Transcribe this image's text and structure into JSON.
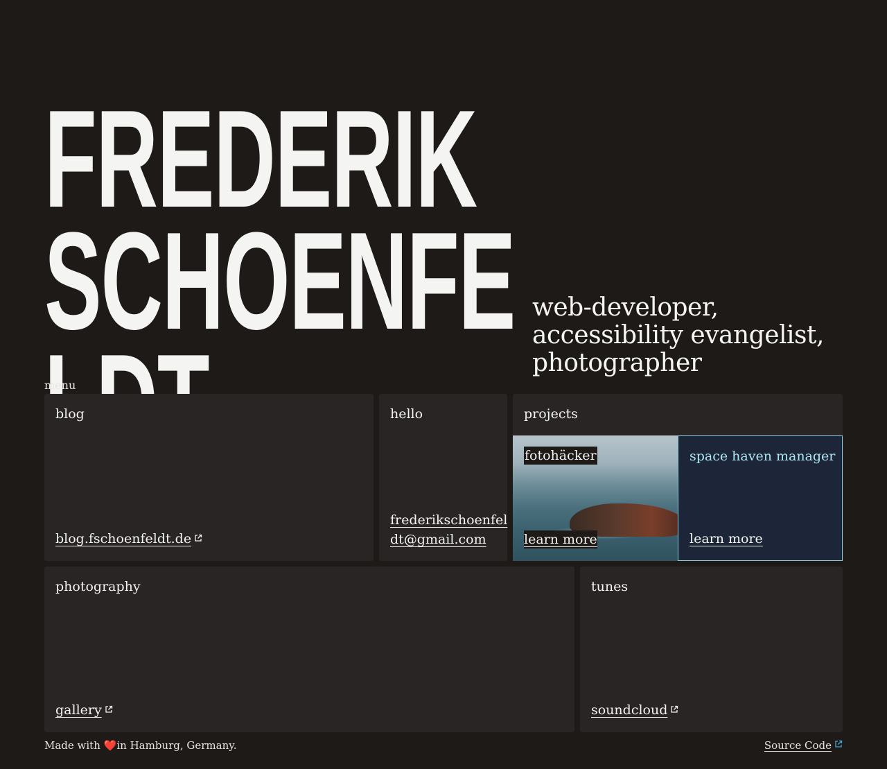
{
  "hero": {
    "name_lines": [
      "FREDERIK",
      "SCHOENFE",
      "LDT"
    ],
    "tagline_lines": [
      "web-developer,",
      "accessibility evangelist,",
      "photographer"
    ]
  },
  "nav": {
    "menu_label": "menu"
  },
  "cards": {
    "blog": {
      "title": "blog",
      "link": "blog.fschoenfeldt.de"
    },
    "hello": {
      "title": "hello",
      "email": "frederikschoenfeldt@gmail.com"
    },
    "projects": {
      "title": "projects",
      "items": [
        {
          "title": "fotohäcker",
          "cta": "learn more"
        },
        {
          "title": "space haven manager",
          "cta": "learn more"
        }
      ]
    },
    "photography": {
      "title": "photography",
      "link": "gallery"
    },
    "tunes": {
      "title": "tunes",
      "link": "soundcloud"
    }
  },
  "footer": {
    "made_with": "Made with",
    "heart": "❤️",
    "location": "in Hamburg, Germany.",
    "source_code": "Source Code"
  },
  "colors": {
    "background": "#1e1a18",
    "card": "#282524",
    "accent_cyan": "#aee6f2",
    "project_tile": "#1c2638"
  }
}
